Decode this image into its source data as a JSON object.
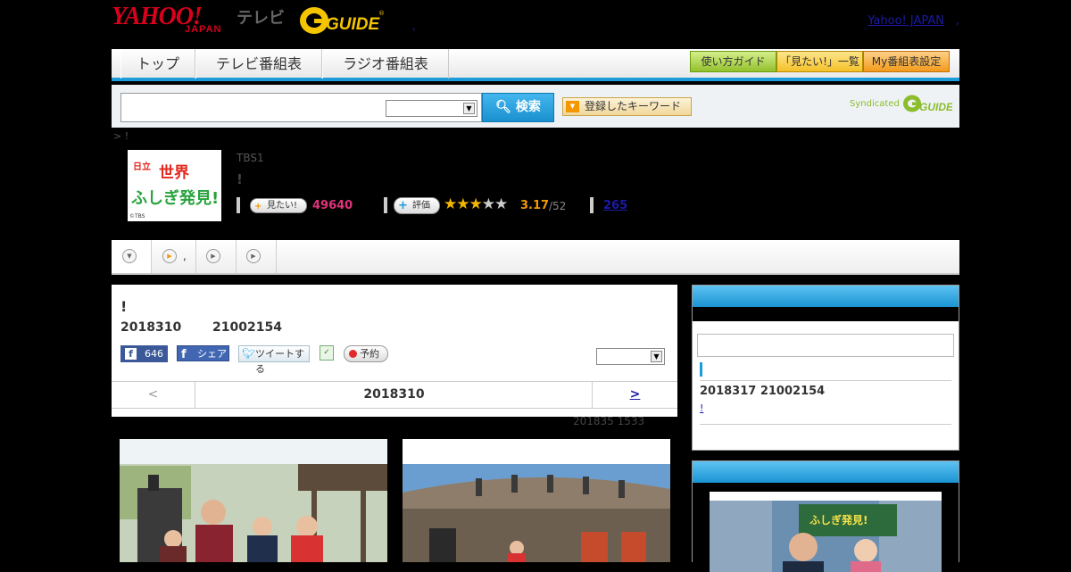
{
  "header": {
    "yahoo_logo": "YAHOO!",
    "japan_logo": "JAPAN",
    "tv_logo": "テレビ",
    "gguide_logo": "G-GUIDE",
    "yahoo_japan_link": "Yahoo! JAPAN",
    "dot": ","
  },
  "nav": {
    "tabs": [
      "トップ",
      "テレビ番組表",
      "ラジオ番組表"
    ],
    "buttons": [
      "使い方ガイド",
      "「見たい!」一覧",
      "My番組表設定"
    ]
  },
  "search": {
    "button_label": "検索",
    "keyword_button": "登録したキーワード",
    "syndicated_label": "Syndicated",
    "syndicated_brand": "G-GUIDE"
  },
  "breadcrumb": "> !",
  "program": {
    "thumb_title_line1": "世界",
    "thumb_title_line2": "ふしぎ発見!",
    "thumb_copyright": "©TBS",
    "thumb_sponsor": "日立",
    "channel": "TBS1",
    "title": "!",
    "mitai_label": "見たい!",
    "mitai_count": "49640",
    "hyoka_label": "評価",
    "rating_stars": 3,
    "rating_value": "3.17",
    "rating_total": "/52",
    "review_count": "265"
  },
  "tabs": [
    {
      "icon": "down-arrow-icon",
      "label": ""
    },
    {
      "icon": "play-icon",
      "label": ","
    },
    {
      "icon": "play-icon",
      "label": ""
    },
    {
      "icon": "play-icon",
      "label": ""
    }
  ],
  "main": {
    "title": "!",
    "date": "2018310",
    "time": "21002154",
    "like_count": "646",
    "share_label": "シェア",
    "tweet_label": "ツイートする",
    "yoyaku_label": "予約",
    "pager": {
      "prev": "<",
      "current": "2018310",
      "next": ">"
    },
    "updated": "201835  1533"
  },
  "sidebar": {
    "next_date": "2018317  21002154",
    "next_link": "!"
  },
  "colors": {
    "accent": "#1c9cd9",
    "mitai": "#e0337a",
    "rating": "#f39800",
    "link": "#1a1aa6"
  }
}
